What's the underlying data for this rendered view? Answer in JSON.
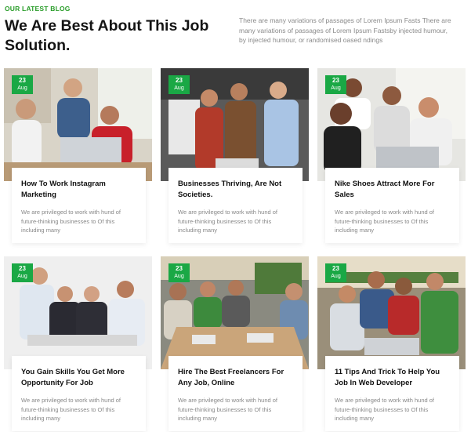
{
  "header": {
    "eyebrow": "OUR LATEST BLOG",
    "title": "We Are Best About This Job Solution.",
    "description": "There are many variations of passages of Lorem Ipsum Fasts There are many variations of passages of Lorem Ipsum Fastsby injected humour, by injected humour, or randomised oased ndings"
  },
  "posts": [
    {
      "day": "23",
      "month": "Aug",
      "title": "How To Work Instagram Marketing",
      "excerpt": "We are privileged to work with hund of future-thinking businesses to Of this including many"
    },
    {
      "day": "23",
      "month": "Aug",
      "title": "Businesses Thriving, Are Not Societies.",
      "excerpt": "We are privileged to work with hund of future-thinking businesses to Of this including many"
    },
    {
      "day": "23",
      "month": "Aug",
      "title": "Nike Shoes Attract More For Sales",
      "excerpt": "We are privileged to work with hund of future-thinking businesses to Of this including many"
    },
    {
      "day": "23",
      "month": "Aug",
      "title": "You Gain Skills You Get More Opportunity For Job",
      "excerpt": "We are privileged to work with hund of future-thinking businesses to Of this including many"
    },
    {
      "day": "23",
      "month": "Aug",
      "title": "Hire The Best Freelancers For Any Job, Online",
      "excerpt": "We are privileged to work with hund of future-thinking businesses to Of this including many"
    },
    {
      "day": "23",
      "month": "Aug",
      "title": "11 Tips And Trick To Help You Job In Web Developer",
      "excerpt": "We are privileged to work with hund of future-thinking businesses to Of this including many"
    }
  ],
  "colors": {
    "accent": "#1aa845",
    "eyebrow": "#2a9d2a",
    "heading": "#141414",
    "muted": "#888888"
  }
}
